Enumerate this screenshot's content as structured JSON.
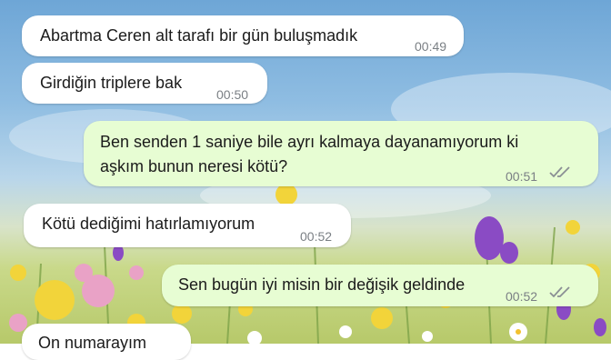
{
  "chat": {
    "messages": [
      {
        "id": "m1",
        "direction": "incoming",
        "text": "Abartma Ceren alt tarafı bir gün buluşmadık",
        "time": "00:49"
      },
      {
        "id": "m2",
        "direction": "incoming",
        "text": "Girdiğin triplere bak",
        "time": "00:50"
      },
      {
        "id": "m3",
        "direction": "outgoing",
        "text_line1": "Ben senden 1 saniye bile ayrı kalmaya dayanamıyorum ki",
        "text_line2": "aşkım bunun neresi kötü?",
        "time": "00:51",
        "status": "read"
      },
      {
        "id": "m4",
        "direction": "incoming",
        "text": "Kötü dediğimi hatırlamıyorum",
        "time": "00:52"
      },
      {
        "id": "m5",
        "direction": "outgoing",
        "text": "Sen bugün iyi misin bir değişik geldinde",
        "time": "00:52",
        "status": "read"
      },
      {
        "id": "m6",
        "direction": "incoming",
        "text": "On numarayım"
      }
    ]
  },
  "colors": {
    "incoming_bubble": "#ffffff",
    "outgoing_bubble": "#e7fdd3",
    "timestamp": "#7a7f84",
    "read_ticks": "#8a8f94"
  }
}
